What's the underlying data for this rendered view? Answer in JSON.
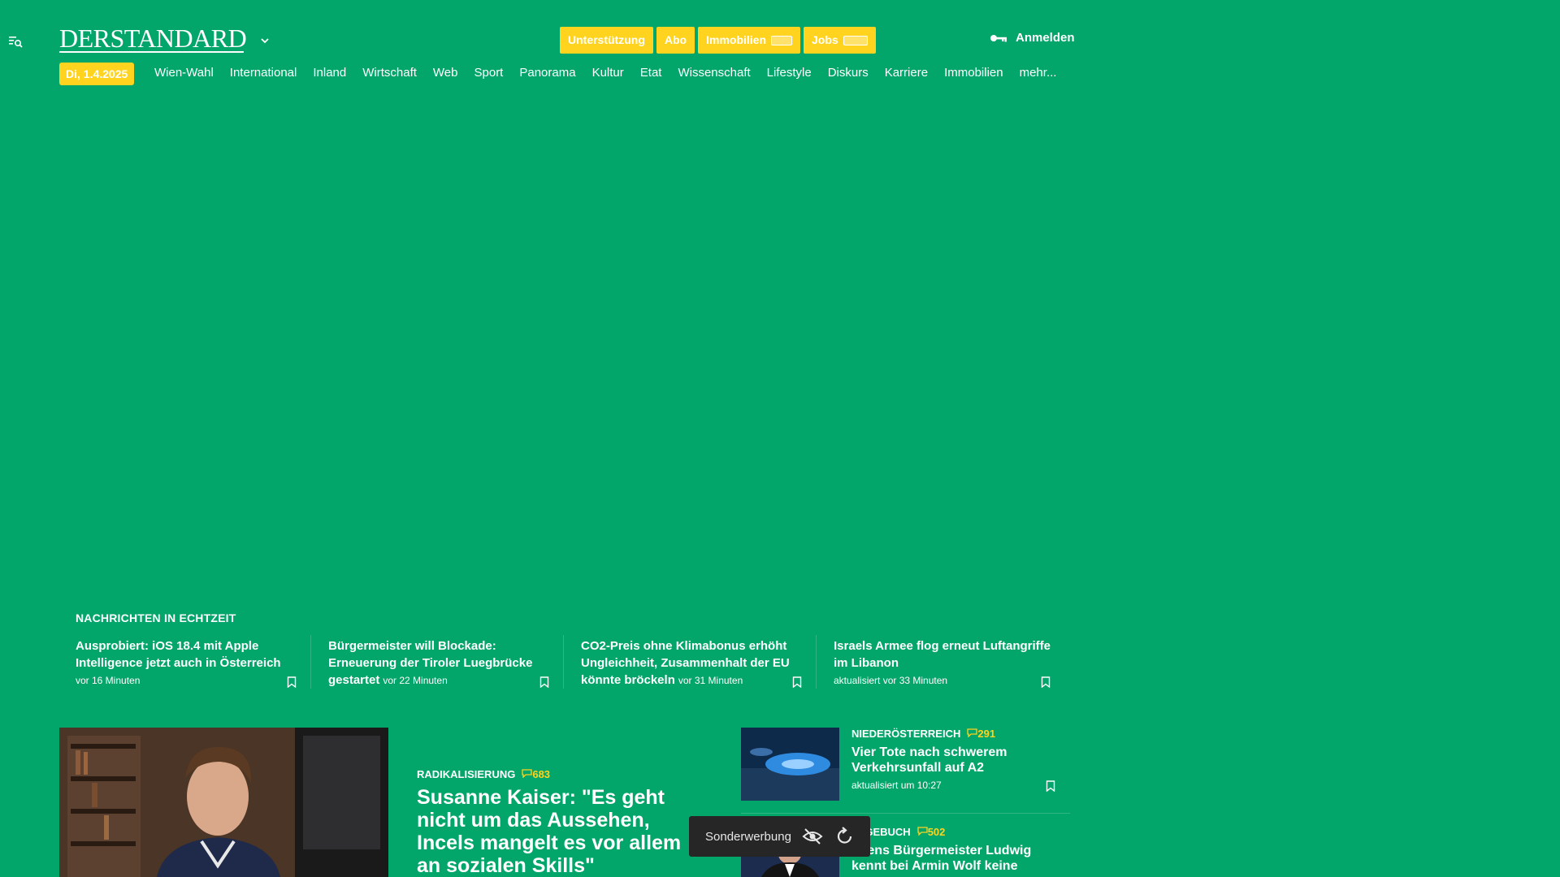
{
  "header": {
    "logo": "DERSTANDARD",
    "buttons": [
      {
        "label": "Unterstützung"
      },
      {
        "label": "Abo"
      },
      {
        "label": "Immobilien"
      },
      {
        "label": "Jobs"
      }
    ],
    "login_label": "Anmelden",
    "date": "Di, 1.4.2025"
  },
  "nav": {
    "items": [
      "Wien-Wahl",
      "International",
      "Inland",
      "Wirtschaft",
      "Web",
      "Sport",
      "Panorama",
      "Kultur",
      "Etat",
      "Wissenschaft",
      "Lifestyle",
      "Diskurs",
      "Karriere",
      "Immobilien",
      "mehr..."
    ]
  },
  "live": {
    "title": "NACHRICHTEN IN ECHTZEIT",
    "items": [
      {
        "title": "Ausprobiert: iOS 18.4 mit Apple Intelligence jetzt auch in Österreich",
        "meta": "vor 16 Minuten"
      },
      {
        "title": "Bürgermeister will Blockade: Erneuerung der Tiroler Luegbrücke gestartet",
        "meta": "vor 22 Minuten"
      },
      {
        "title": "CO2-Preis ohne Klimabonus erhöht Ungleichheit, Zusammenhalt der EU könnte bröckeln",
        "meta": "vor 31 Minuten"
      },
      {
        "title": "Israels Armee flog erneut Luftangriffe im Libanon",
        "meta": "aktualisiert vor 33 Minuten"
      }
    ]
  },
  "main_article": {
    "kicker": "RADIKALISIERUNG",
    "comments": "683",
    "title": "Susanne Kaiser: \"Es geht nicht um das Aussehen, Incels mangelt es vor allem an sozialen Skills\""
  },
  "side_articles": [
    {
      "kicker": "NIEDERÖSTERREICH",
      "comments": "291",
      "title": "Vier Tote nach schwerem Verkehrsunfall auf A2",
      "meta": "aktualisiert um 10:27"
    },
    {
      "kicker": "TAGEBUCH",
      "comments": "502",
      "title": "Wiens Bürgermeister Ludwig kennt bei Armin Wolf keine",
      "meta": ""
    }
  ],
  "ad": {
    "label": "Sonderwerbung"
  },
  "colors": {
    "background": "#03a66a",
    "accent": "#ffd31e",
    "ad_bar": "#262626"
  }
}
